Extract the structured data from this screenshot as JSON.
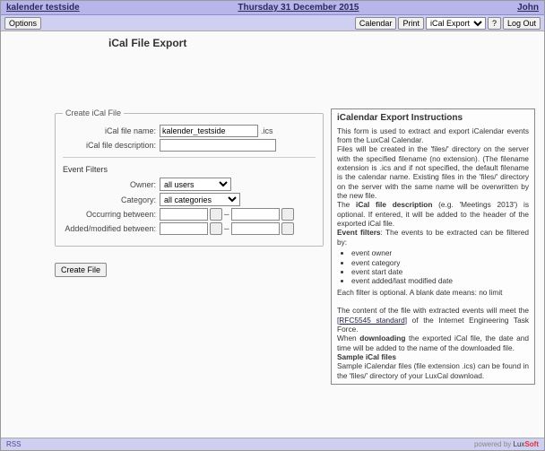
{
  "header": {
    "app_name": "kalender testside",
    "date": "Thursday 31 December 2015",
    "user": "John"
  },
  "toolbar": {
    "options": "Options",
    "calendar": "Calendar",
    "print": "Print",
    "view_select": "iCal Export",
    "help": "?",
    "logout": "Log Out"
  },
  "page_title": "iCal File Export",
  "form": {
    "fieldset_legend": "Create iCal File",
    "file_name_label": "iCal file name:",
    "file_name_value": "kalender_testside",
    "file_ext": ".ics",
    "file_desc_label": "iCal file description:",
    "file_desc_value": "",
    "filters_head": "Event Filters",
    "owner_label": "Owner:",
    "owner_value": "all users",
    "category_label": "Category:",
    "category_value": "all categories",
    "occurring_label": "Occurring between:",
    "occurring_from": "",
    "occurring_to": "",
    "modified_label": "Added/modified between:",
    "modified_from": "",
    "modified_to": "",
    "create_button": "Create File"
  },
  "instructions": {
    "title": "iCalendar Export Instructions",
    "p1": "This form is used to extract and export iCalendar events from the LuxCal Calendar.",
    "p2": "Files will be created in the 'files/' directory on the server with the specified filename (no extension). (The filename extension is .ics and if not specified, the default filename is the calendar name. Existing files in the 'files/' directory on the server with the same name will be overwritten by the new file.",
    "p3a": "The ",
    "p3b": "iCal file description",
    "p3c": " (e.g. 'Meetings 2013') is optional. If entered, it will be added to the header of the exported iCal file.",
    "p4a": "Event filters",
    "p4b": ": The events to be extracted can be filtered by:",
    "bullets": [
      "event owner",
      "event category",
      "event start date",
      "event added/last modified date"
    ],
    "p5": "Each filter is optional. A blank date means: no limit",
    "p6a": "The content of the file with extracted events will meet the ",
    "p6link": "[RFC5545 standard]",
    "p6b": " of the Internet Engineering Task Force.",
    "p7a": "When ",
    "p7b": "downloading",
    "p7c": " the exported iCal file, the date and time will be added to the name of the downloaded file.",
    "p8": "Sample iCal files",
    "p9": "Sample iCalendar files (file extension .ics) can be found in the 'files/' directory of your LuxCal download."
  },
  "footer": {
    "rss": "RSS",
    "powered": "powered by ",
    "lux": "Lux",
    "soft": "Soft"
  }
}
